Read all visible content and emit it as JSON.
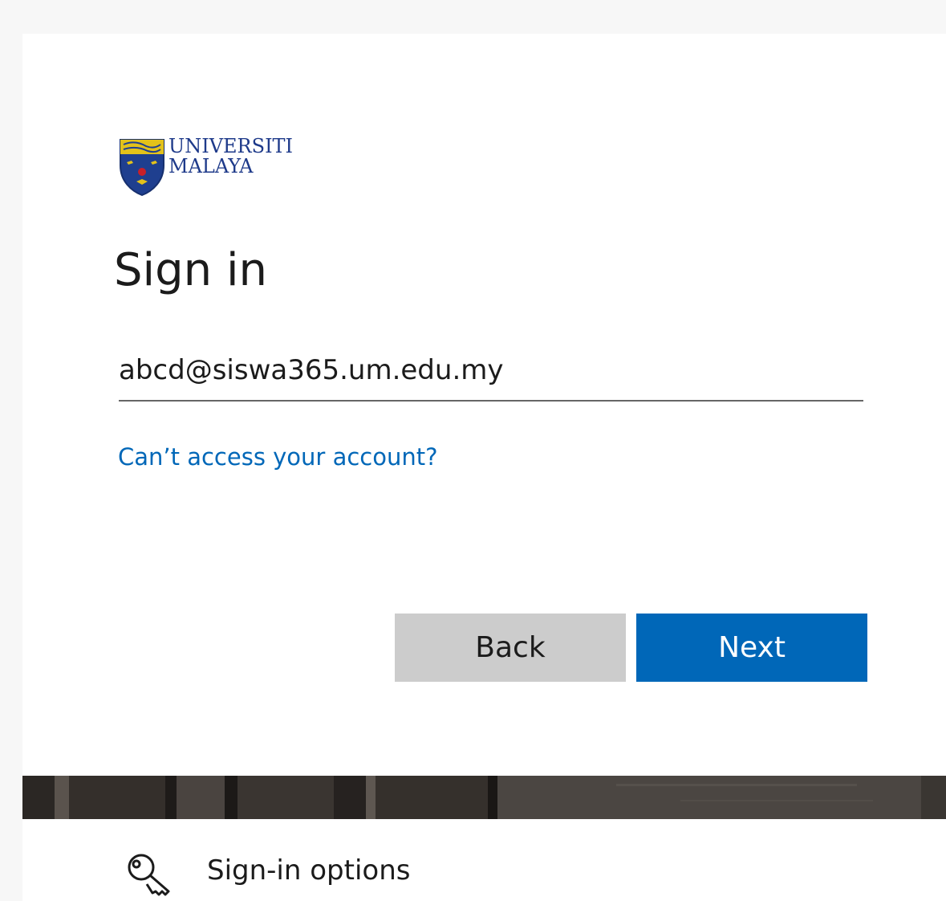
{
  "logo": {
    "line1": "UNIVERSITI",
    "line2": "MALAYA"
  },
  "title": "Sign in",
  "email": {
    "value": "abcd@siswa365.um.edu.my"
  },
  "links": {
    "cant_access": "Can’t access your account?"
  },
  "buttons": {
    "back": "Back",
    "next": "Next"
  },
  "signin_options": {
    "label": "Sign-in options",
    "icon": "key-icon"
  },
  "colors": {
    "accent": "#0067b8",
    "back_button": "#cccccc",
    "text": "#1b1b1b"
  }
}
